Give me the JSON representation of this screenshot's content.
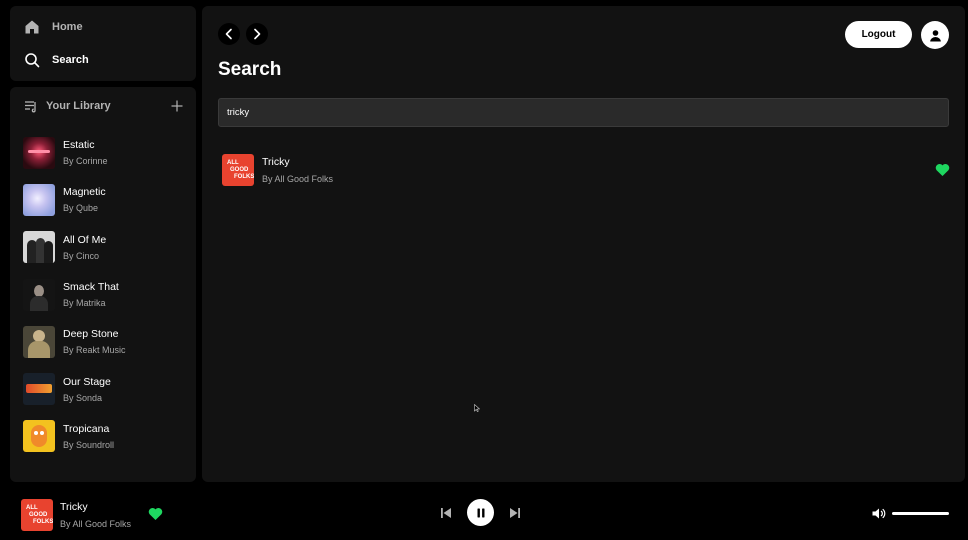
{
  "nav": {
    "home_label": "Home",
    "search_label": "Search"
  },
  "library": {
    "title": "Your Library",
    "items": [
      {
        "name": "Estatic",
        "artist": "By Corinne",
        "icon": "estatic-cover",
        "color": "#5a1a24"
      },
      {
        "name": "Magnetic",
        "artist": "By Qube",
        "icon": "magnetic-cover",
        "color": "#b9bde8"
      },
      {
        "name": "All Of Me",
        "artist": "By Cinco",
        "icon": "all-of-me-cover",
        "color": "#cfcfcf"
      },
      {
        "name": "Smack That",
        "artist": "By Matrika",
        "icon": "smack-that-cover",
        "color": "#1a1a1a"
      },
      {
        "name": "Deep Stone",
        "artist": "By Reakt Music",
        "icon": "deep-stone-cover",
        "color": "#6e6a5e"
      },
      {
        "name": "Our Stage",
        "artist": "By Sonda",
        "icon": "our-stage-cover",
        "color": "#1d2630"
      },
      {
        "name": "Tropicana",
        "artist": "By Soundroll",
        "icon": "tropicana-cover",
        "color": "#f0c020"
      }
    ]
  },
  "header": {
    "logout_label": "Logout",
    "title": "Search"
  },
  "search": {
    "value": "tricky"
  },
  "results": [
    {
      "name": "Tricky",
      "artist": "By All Good Folks",
      "liked": true
    }
  ],
  "now_playing": {
    "name": "Tricky",
    "artist": "By All Good Folks",
    "liked": true,
    "is_playing": true,
    "volume": 1.0
  },
  "colors": {
    "accent": "#1ed760",
    "panel": "#121212",
    "background": "#000000",
    "cover_red": "#e8432f"
  }
}
